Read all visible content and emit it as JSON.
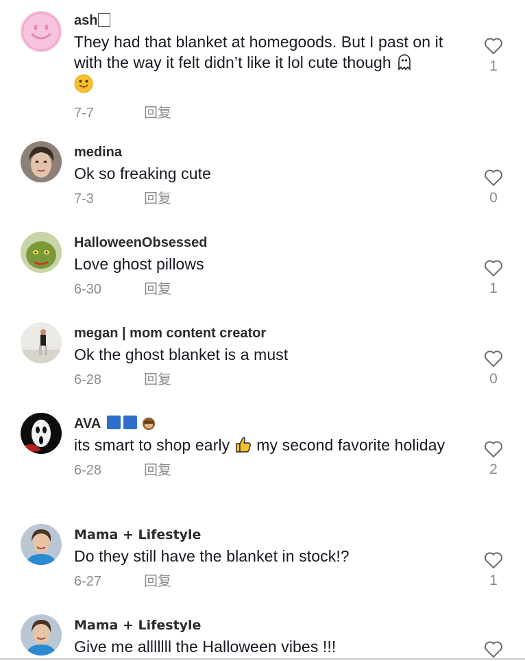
{
  "comments": [
    {
      "username": "ash",
      "text": "They had that blanket at homegoods. But I past on it with the way it felt didn’t like it lol cute though",
      "date": "7-7",
      "reply_label": "回复",
      "like_count": "1"
    },
    {
      "username": "medina",
      "text": "Ok so freaking cute",
      "date": "7-3",
      "reply_label": "回复",
      "like_count": "0"
    },
    {
      "username": "HalloweenObsessed",
      "text": "Love ghost pillows",
      "date": "6-30",
      "reply_label": "回复",
      "like_count": "1"
    },
    {
      "username": "megan | mom content creator",
      "text": "Ok the ghost blanket is a must",
      "date": "6-28",
      "reply_label": "回复",
      "like_count": "0"
    },
    {
      "username": "AVA",
      "text_part1": "its smart to shop early",
      "text_part2": "my second favorite holiday",
      "date": "6-28",
      "reply_label": "回复",
      "like_count": "2"
    },
    {
      "username": "Mama + Lifestyle",
      "text": "Do they still have the blanket in stock!?",
      "date": "6-27",
      "reply_label": "回复",
      "like_count": "1"
    },
    {
      "username": "Mama + Lifestyle",
      "text": "Give me alllllll the Halloween vibes !!!"
    }
  ],
  "icons": {
    "like": "heart-outline-icon",
    "ghost": "ghost-emoji-icon",
    "smile": "tongue-out-emoji-icon",
    "thumbs": "thumbs-up-emoji-icon"
  },
  "colors": {
    "text": "#161823",
    "muted": "#8a8b91",
    "username": "#2b2b2b"
  }
}
